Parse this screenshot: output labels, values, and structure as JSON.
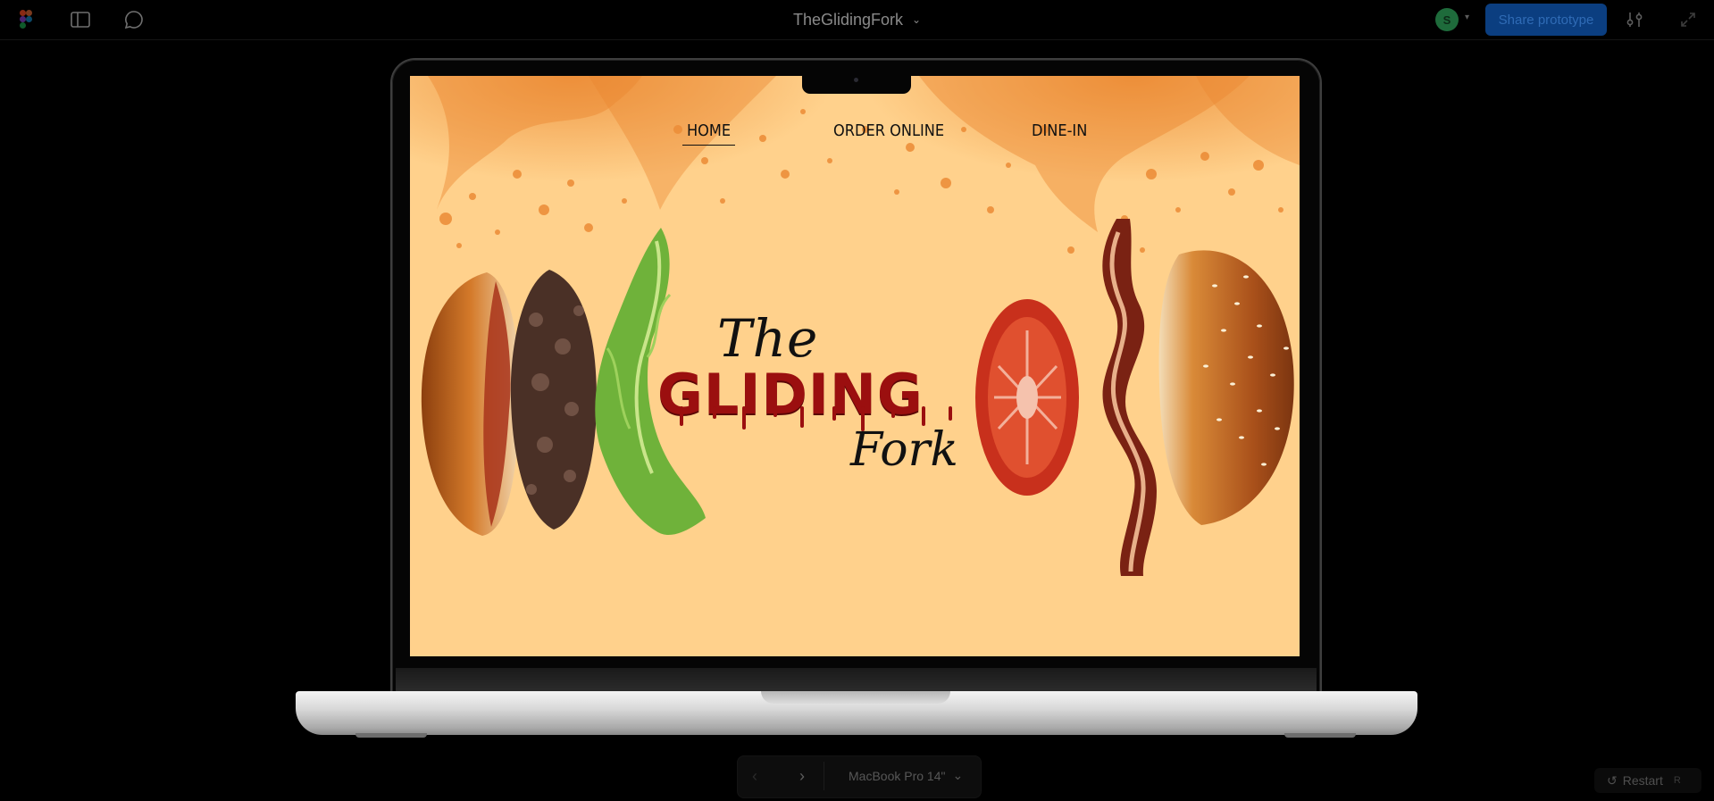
{
  "topbar": {
    "project_title": "TheGlidingFork",
    "avatar_initial": "S",
    "share_label": "Share prototype"
  },
  "site": {
    "nav": [
      "HOME",
      "ORDER ONLINE",
      "DINE-IN"
    ],
    "active_nav": "HOME",
    "logo": {
      "line1": "The",
      "line2": "GLIDING",
      "line3": "Fork"
    }
  },
  "controls": {
    "device_label": "MacBook Pro 14\"",
    "restart_label": "Restart",
    "restart_shortcut": "R"
  },
  "colors": {
    "page_bg": "#ffd18c",
    "splash": "#e9822a",
    "logo_red": "#9b0f0f",
    "share_button": "#0b3e80"
  }
}
